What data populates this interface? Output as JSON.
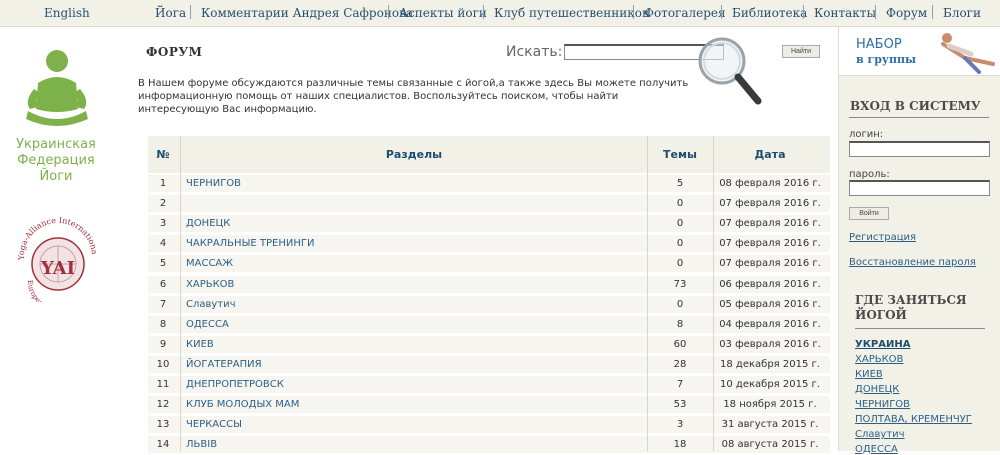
{
  "nav": {
    "english": "English",
    "items": [
      "Йога",
      "Комментарии Андрея Сафронова",
      "Аспекты йоги",
      "Клуб путешественников",
      "Фотогалерея",
      "Библиотека",
      "Контакты",
      "Форум",
      "Блоги"
    ]
  },
  "logo": {
    "federation": "Украинская Федерация Йоги",
    "alliance": "Yoga-Alliance International",
    "yai": "YAI",
    "division": "European Division"
  },
  "forum": {
    "title": "ФОРУМ",
    "search_label": "Искать:",
    "search_value": "",
    "search_button": "Найти",
    "intro": "В Нашем форуме обсуждаются различные темы связанные с йогой,а также здесь Вы можете получить информационную помощь от наших специалистов. Воспользуйтесь поиском, чтобы найти интересующую Вас информацию."
  },
  "table": {
    "headers": {
      "num": "№",
      "section": "Разделы",
      "topics": "Темы",
      "date": "Дата"
    },
    "rows": [
      {
        "num": "1",
        "section": "ЧЕРНИГОВ",
        "topics": "5",
        "date": "08 февраля 2016 г."
      },
      {
        "num": "2",
        "section": "",
        "topics": "0",
        "date": "07 февраля 2016 г."
      },
      {
        "num": "3",
        "section": "ДОНЕЦК",
        "topics": "0",
        "date": "07 февраля 2016 г."
      },
      {
        "num": "4",
        "section": "ЧАКРАЛЬНЫЕ ТРЕНИНГИ",
        "topics": "0",
        "date": "07 февраля 2016 г."
      },
      {
        "num": "5",
        "section": "МАССАЖ",
        "topics": "0",
        "date": "07 февраля 2016 г."
      },
      {
        "num": "6",
        "section": "ХАРЬКОВ",
        "topics": "73",
        "date": "06 февраля 2016 г."
      },
      {
        "num": "7",
        "section": "Славутич",
        "topics": "0",
        "date": "05 февраля 2016 г."
      },
      {
        "num": "8",
        "section": "ОДЕССА",
        "topics": "8",
        "date": "04 февраля 2016 г."
      },
      {
        "num": "9",
        "section": "КИЕВ",
        "topics": "60",
        "date": "03 февраля 2016 г."
      },
      {
        "num": "10",
        "section": "ЙОГАТЕРАПИЯ",
        "topics": "28",
        "date": "18 декабря 2015 г."
      },
      {
        "num": "11",
        "section": "ДНЕПРОПЕТРОВСК",
        "topics": "7",
        "date": "10 декабря 2015 г."
      },
      {
        "num": "12",
        "section": "КЛУБ МОЛОДЫХ МАМ",
        "topics": "53",
        "date": "18 ноября 2015 г."
      },
      {
        "num": "13",
        "section": "ЧЕРКАССЫ",
        "topics": "3",
        "date": "31 августа 2015 г."
      },
      {
        "num": "14",
        "section": "ЛЬВІВ",
        "topics": "18",
        "date": "08 августа 2015 г."
      }
    ]
  },
  "sidebar": {
    "banner_line1": "НАБОР",
    "banner_line2": "в группы",
    "login_title": "ВХОД В СИСТЕМУ",
    "login_label": "логин:",
    "password_label": "пароль:",
    "login_button": "Войти",
    "register_link": "Регистрация",
    "restore_link": "Восстановление пароля",
    "where_title": "ГДЕ ЗАНЯТЬСЯ ЙОГОЙ",
    "cities": [
      "УКРАИНА",
      "ХАРЬКОВ",
      "КИЕВ",
      "ДОНЕЦК",
      "ЧЕРНИГОВ",
      "ПОЛТАВА, КРЕМЕНЧУГ",
      "Славутич",
      "ОДЕССА"
    ]
  },
  "colors": {
    "accent": "#27506c",
    "link": "#2c5f86",
    "logo_green": "#7db24a",
    "panel_bg": "#f2f1e8"
  }
}
